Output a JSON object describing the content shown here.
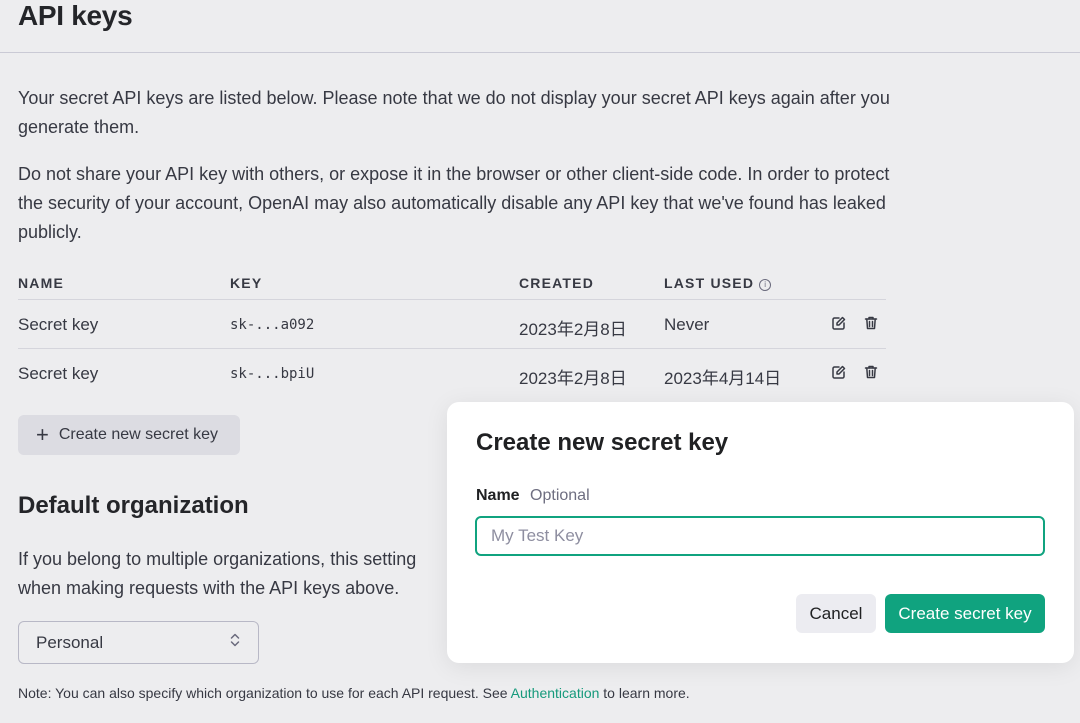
{
  "page": {
    "title": "API keys",
    "intro_1": "Your secret API keys are listed below. Please note that we do not display your secret API keys again after you generate them.",
    "intro_2": "Do not share your API key with others, or expose it in the browser or other client-side code. In order to protect the security of your account, OpenAI may also automatically disable any API key that we've found has leaked publicly."
  },
  "table": {
    "columns": {
      "name": "NAME",
      "key": "KEY",
      "created": "CREATED",
      "last_used": "LAST USED"
    },
    "info_icon": "info-circle-icon",
    "rows": [
      {
        "name": "Secret key",
        "key": "sk-...a092",
        "created": "2023年2月8日",
        "last_used": "Never"
      },
      {
        "name": "Secret key",
        "key": "sk-...bpiU",
        "created": "2023年2月8日",
        "last_used": "2023年4月14日"
      }
    ],
    "row_actions": [
      "edit-icon",
      "trash-icon"
    ]
  },
  "create_button": {
    "icon": "+",
    "label": "Create new secret key"
  },
  "default_org": {
    "heading": "Default organization",
    "description_line_1": "If you belong to multiple organizations, this setting",
    "description_line_2": "when making requests with the API keys above.",
    "selected": "Personal",
    "note_prefix": "Note: You can also specify which organization to use for each API request. See ",
    "note_link": "Authentication",
    "note_suffix": " to learn more."
  },
  "modal": {
    "title": "Create new secret key",
    "name_label": "Name",
    "optional_label": "Optional",
    "input_placeholder": "My Test Key",
    "input_value": "",
    "cancel_label": "Cancel",
    "submit_label": "Create secret key"
  },
  "colors": {
    "accent": "#10a37f",
    "text": "#353740",
    "muted": "#6e6e80",
    "button_secondary_bg": "#ececf1"
  }
}
